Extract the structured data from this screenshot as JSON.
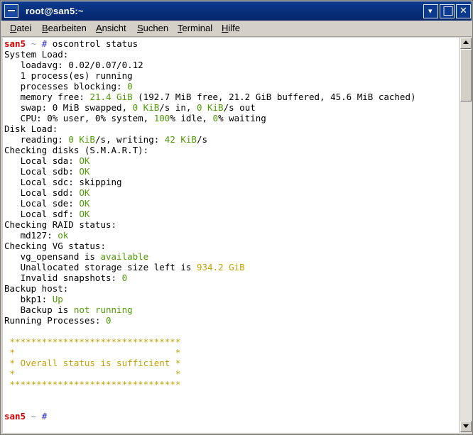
{
  "window": {
    "title": "root@san5:~"
  },
  "titlebar_buttons": {
    "menu_glyph": "▾",
    "maximize_glyph": "□",
    "close_glyph": "✕"
  },
  "menu": {
    "items": [
      {
        "pre": "",
        "u": "D",
        "post": "atei"
      },
      {
        "pre": "",
        "u": "B",
        "post": "earbeiten"
      },
      {
        "pre": "",
        "u": "A",
        "post": "nsicht"
      },
      {
        "pre": "",
        "u": "S",
        "post": "uchen"
      },
      {
        "pre": "",
        "u": "T",
        "post": "erminal"
      },
      {
        "pre": "",
        "u": "H",
        "post": "ilfe"
      }
    ]
  },
  "terminal": {
    "prompt_host": "san5",
    "prompt_path": "~",
    "prompt_symbol": "#",
    "command": "oscontrol status",
    "system_load_header": "System Load:",
    "loadavg_label": "loadavg: ",
    "loadavg_value": "0.02/0.07/0.12",
    "processes_running": "1 process(es) running",
    "processes_blocking_label": "processes blocking: ",
    "processes_blocking_value": "0",
    "memory_free_label": "memory free: ",
    "memory_free_value": "21.4 GiB",
    "memory_free_detail": "(192.7 MiB free, 21.2 GiB buffered, 45.6 MiB cached)",
    "swap_label": "swap: 0 MiB swapped, ",
    "swap_in_value": "0 KiB",
    "swap_in_label": "/s in, ",
    "swap_out_value": "0 KiB",
    "swap_out_label": "/s out",
    "cpu_label": "CPU: 0% user, 0% system, ",
    "cpu_idle_value": "100",
    "cpu_idle_label": "% idle, ",
    "cpu_wait_value": "0",
    "cpu_wait_label": "% waiting",
    "disk_load_header": "Disk Load:",
    "reading_label": "reading: ",
    "reading_value": "0 KiB",
    "writing_label": "/s, writing: ",
    "writing_value": "42 KiB",
    "writing_unit": "/s",
    "smart_header": "Checking disks (S.M.A.R.T):",
    "disks": [
      {
        "label": "Local sda: ",
        "status": "OK",
        "ok": true
      },
      {
        "label": "Local sdb: ",
        "status": "OK",
        "ok": true
      },
      {
        "label": "Local sdc: ",
        "status": "skipping",
        "ok": false
      },
      {
        "label": "Local sdd: ",
        "status": "OK",
        "ok": true
      },
      {
        "label": "Local sde: ",
        "status": "OK",
        "ok": true
      },
      {
        "label": "Local sdf: ",
        "status": "OK",
        "ok": true
      }
    ],
    "raid_header": "Checking RAID status:",
    "raid_label": "md127: ",
    "raid_value": "ok",
    "vg_header": "Checking VG status:",
    "vg_label": "vg_opensand is ",
    "vg_value": "available",
    "unalloc_label": "Unallocated storage size left is ",
    "unalloc_value": "934.2 GiB",
    "snapshots_label": "Invalid snapshots: ",
    "snapshots_value": "0",
    "backup_header": "Backup host:",
    "bkp_label": "bkp1: ",
    "bkp_value": "Up",
    "backup_label": "Backup is ",
    "backup_value": "not running",
    "running_label": "Running Processes: ",
    "running_value": "0",
    "banner_border": "********************************",
    "banner_edge": "*                              *",
    "banner_message": "* Overall status is sufficient *"
  },
  "colors": {
    "ok_green": "#4e9a06",
    "value_yellow": "#c4a000",
    "prompt_red": "#d00000",
    "prompt_blue": "#2a2acb"
  }
}
